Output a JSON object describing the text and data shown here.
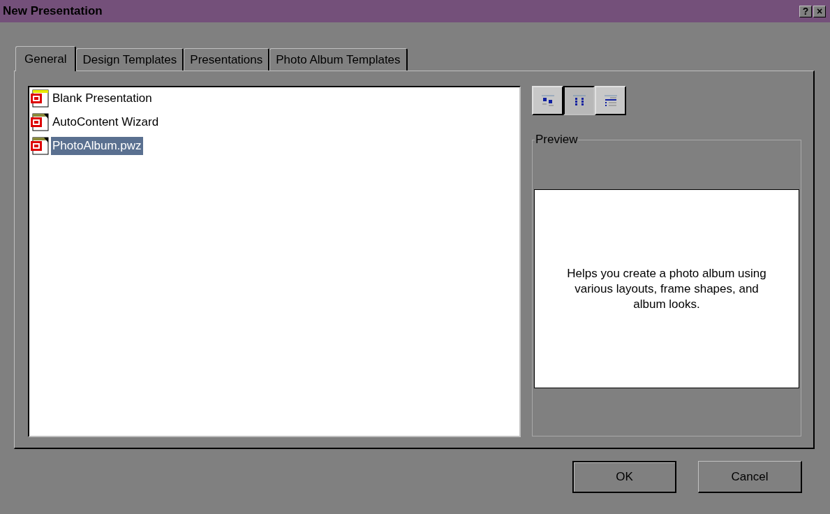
{
  "window": {
    "title": "New Presentation",
    "title_buttons": [
      "?",
      "×"
    ]
  },
  "tabs": [
    {
      "label": "General",
      "selected": true
    },
    {
      "label": "Design Templates",
      "selected": false
    },
    {
      "label": "Presentations",
      "selected": false
    },
    {
      "label": "Photo Album Templates",
      "selected": false
    }
  ],
  "files": [
    {
      "name": "Blank Presentation",
      "kind": "blank",
      "selected": false
    },
    {
      "name": "AutoContent Wizard",
      "kind": "wizard",
      "selected": false
    },
    {
      "name": "PhotoAlbum.pwz",
      "kind": "wizard",
      "selected": true
    }
  ],
  "view_buttons": [
    {
      "kind": "large",
      "selected": false
    },
    {
      "kind": "list",
      "selected": true
    },
    {
      "kind": "details",
      "selected": false
    }
  ],
  "preview": {
    "label": "Preview",
    "description": "Helps you create a photo album using various layouts, frame shapes, and album looks."
  },
  "buttons": [
    {
      "label": "OK",
      "default": true
    },
    {
      "label": "Cancel",
      "default": false
    }
  ]
}
